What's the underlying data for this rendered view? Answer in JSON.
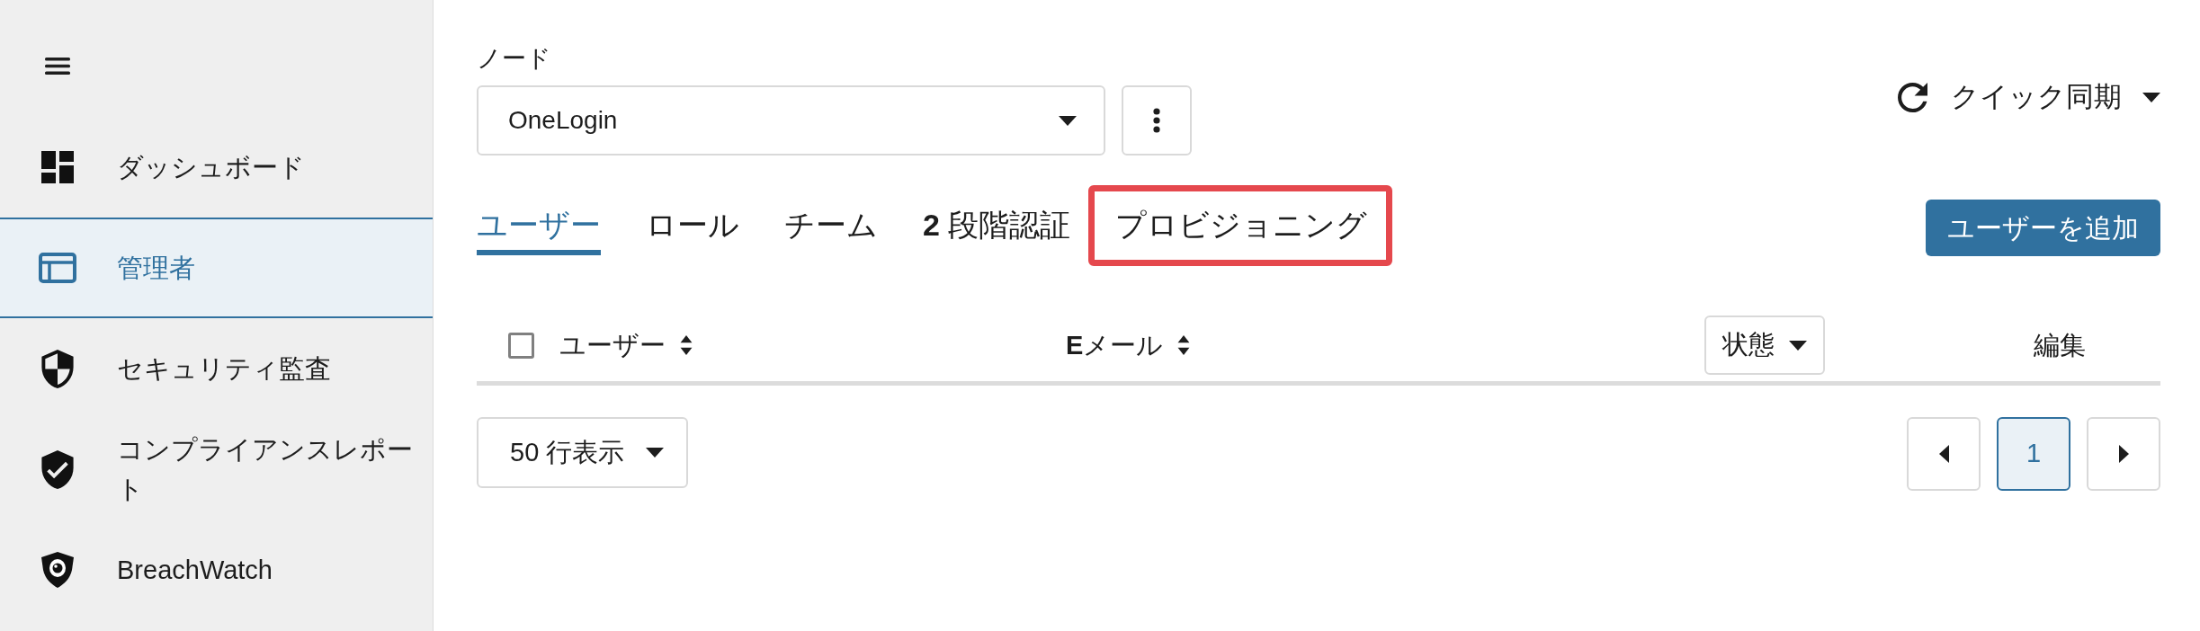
{
  "sidebar": {
    "items": [
      {
        "kind": "dashboard",
        "label": "ダッシュボード",
        "selected": false
      },
      {
        "kind": "admin",
        "label": "管理者",
        "selected": true
      },
      {
        "kind": "security",
        "label": "セキュリティ監査",
        "selected": false
      },
      {
        "kind": "compliance",
        "label": "コンプライアンスレポート",
        "selected": false
      },
      {
        "kind": "breachwatch",
        "label": "BreachWatch",
        "selected": false
      }
    ]
  },
  "node": {
    "label": "ノード",
    "value": "OneLogin"
  },
  "quick_sync": {
    "label": "クイック同期"
  },
  "tabs": [
    {
      "label": "ユーザー",
      "selected": true,
      "highlighted": false
    },
    {
      "label": "ロール",
      "selected": false,
      "highlighted": false
    },
    {
      "label": "チーム",
      "selected": false,
      "highlighted": false
    },
    {
      "label": "**2** 段階認証",
      "selected": false,
      "highlighted": false
    },
    {
      "label": "プロビジョニング",
      "selected": false,
      "highlighted": true
    }
  ],
  "add_user_button": {
    "label": "ユーザーを追加"
  },
  "table": {
    "select_all": {
      "checked": false
    },
    "columns": [
      {
        "kind": "sortable",
        "label": "ユーザー"
      },
      {
        "kind": "sortable",
        "label": "**E**メール"
      },
      {
        "kind": "filter",
        "label": "状態"
      },
      {
        "kind": "plain",
        "label": "編集"
      }
    ]
  },
  "footer": {
    "rows_per_page": "50 行表示",
    "pages": [
      {
        "label": "1",
        "selected": true
      }
    ]
  }
}
